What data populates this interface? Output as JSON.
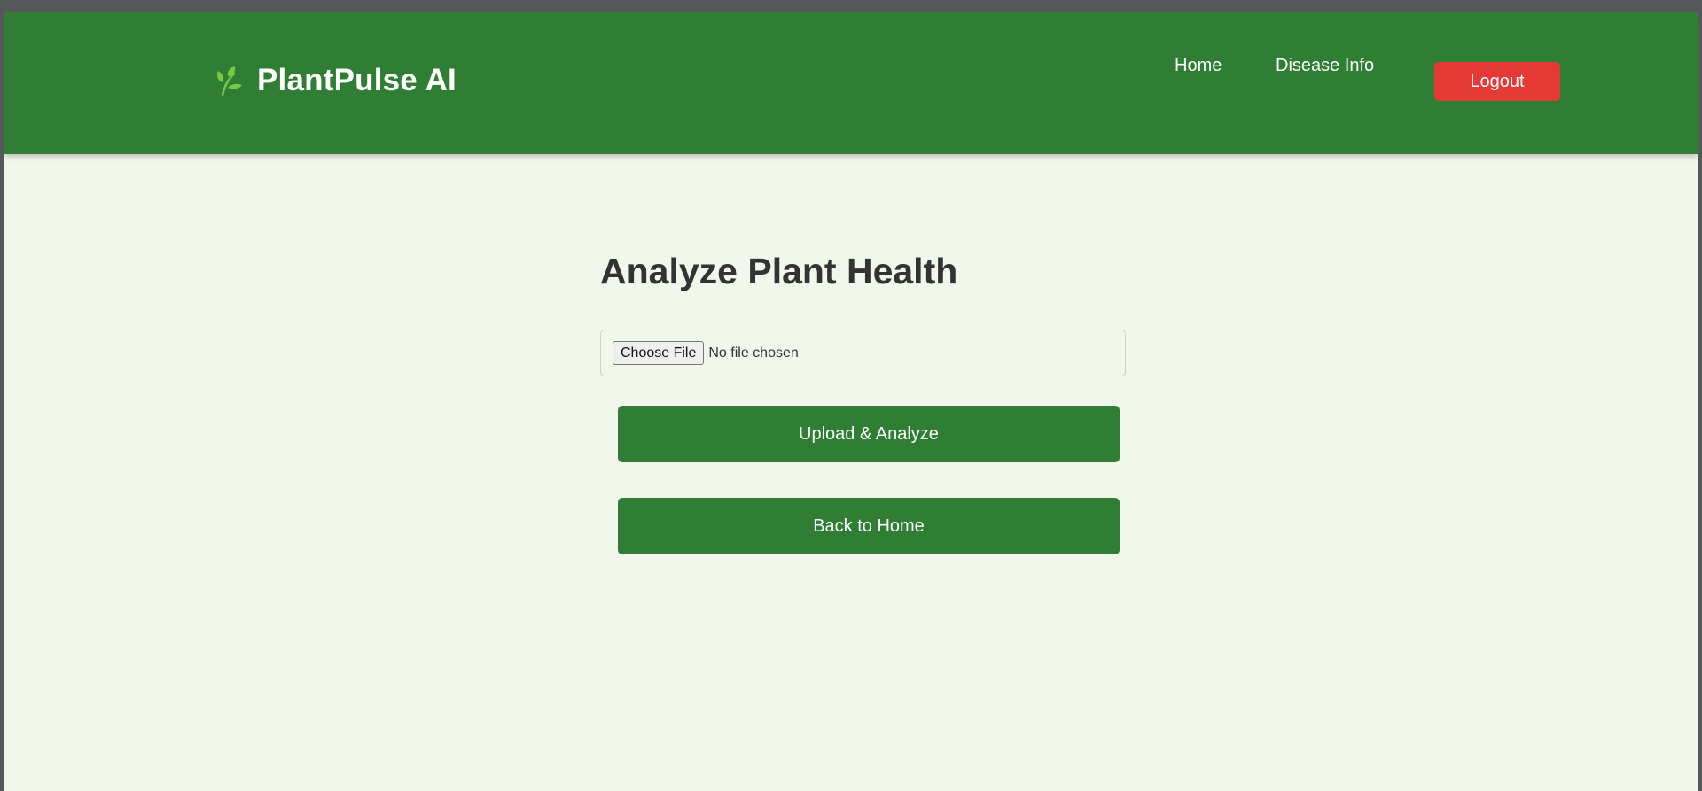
{
  "brand": {
    "name": "PlantPulse AI",
    "icon": "leaf-icon",
    "icon_color": "#7ac943"
  },
  "nav": {
    "home_label": "Home",
    "disease_label": "Disease Info",
    "logout_label": "Logout"
  },
  "main": {
    "title": "Analyze Plant Health",
    "file_input": {
      "button_label": "Choose File",
      "status": "No file chosen"
    },
    "upload_label": "Upload & Analyze",
    "back_label": "Back to Home"
  },
  "colors": {
    "navbar": "#2f7e33",
    "page_background": "#f1f7ea",
    "primary_button": "#2f7e33",
    "logout_button": "#e53935"
  }
}
